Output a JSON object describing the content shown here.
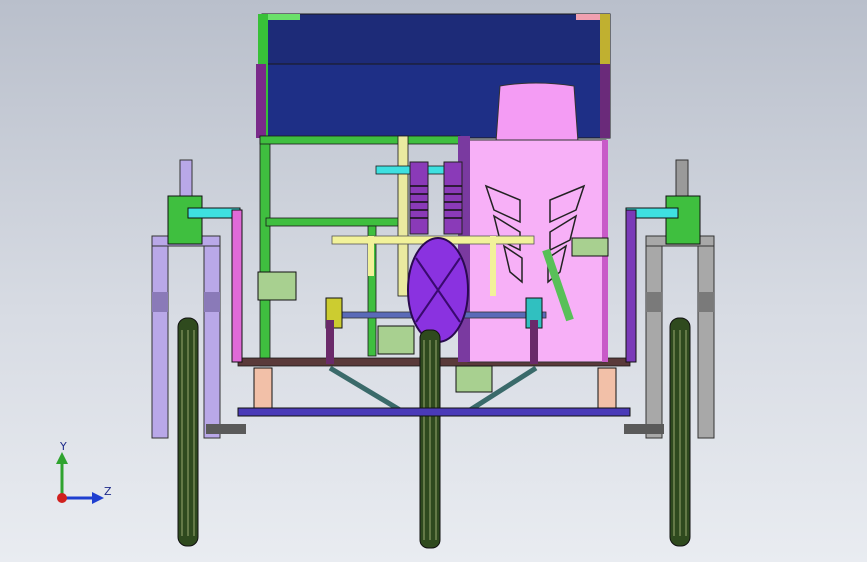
{
  "viewport": {
    "background_top": "#b9bfcb",
    "background_bottom": "#e9ecf1",
    "model_name": "tricycle-assembly"
  },
  "triad": {
    "y_label": "Y",
    "z_label": "Z",
    "y_color": "#2fa32f",
    "z_color": "#1f3fd0",
    "origin_color": "#d0201e"
  },
  "colors": {
    "canopy": "#1d2b78",
    "frame_green": "#3fbf3f",
    "frame_dark": "#4a3a3a",
    "seat": "#f49cf4",
    "fork": "#b9a8e8",
    "wheel": "#2f4a1e",
    "hub_motor": "#8a32e0",
    "axle": "#5a5ab8",
    "crossbar": "#f2f29a",
    "cyan": "#3ee0e0",
    "brake_pink": "#e06ad8"
  },
  "icons": [
    "triad-axis-icon",
    "origin-icon"
  ]
}
